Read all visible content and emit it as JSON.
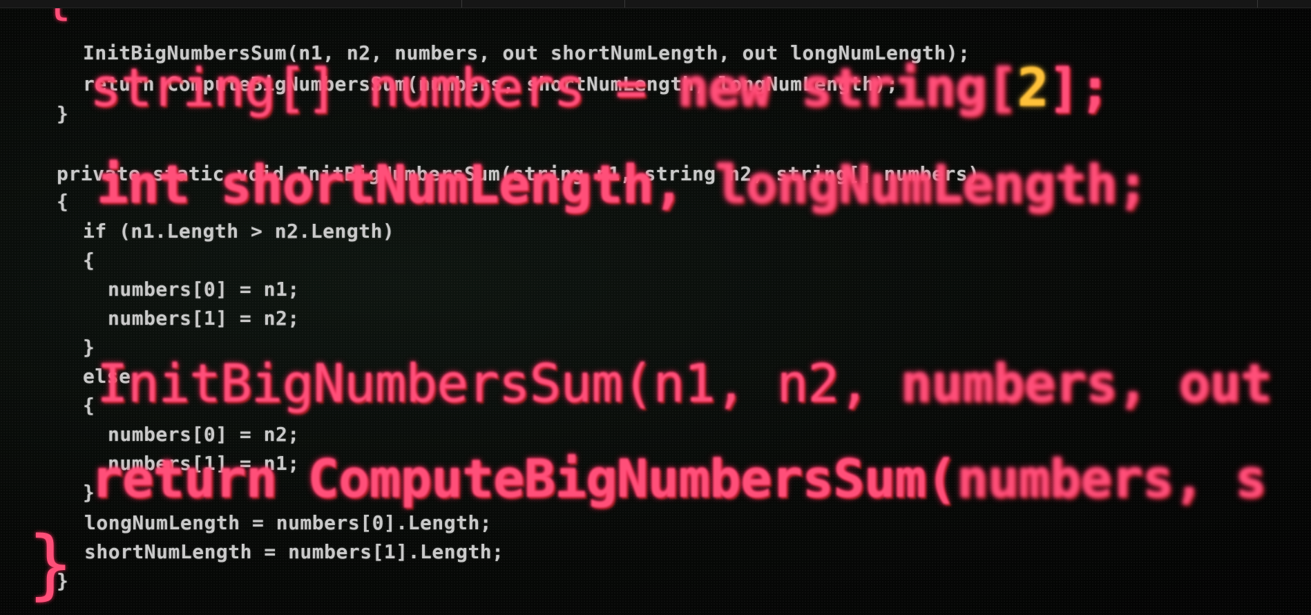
{
  "background_code": [
    "InitBigNumbersSum(n1, n2, numbers, out shortNumLength, out longNumLength);",
    "return ComputeBigNumbersSum(numbers, shortNumLength, longNumLength);",
    "}",
    "private static void InitBigNumbersSum(string n1, string n2, string[] numbers)",
    "{",
    "if (n1.Length > n2.Length)",
    "{",
    "numbers[0] = n1;",
    "numbers[1] = n2;",
    "}",
    "else",
    "{",
    "numbers[0] = n2;",
    "numbers[1] = n1;",
    "}",
    "longNumLength = numbers[0].Length;",
    "shortNumLength = numbers[1].Length;",
    "}"
  ],
  "foreground_code": {
    "line1_a": "string[] numbers = ",
    "line1_b": "new string[",
    "line1_num": "2",
    "line1_c": "];",
    "line2_a": "int shortNumLength, ",
    "line2_b": "longNumLength;",
    "line3_a": "InitBigNumbersSum(n1, n2, ",
    "line3_b": "numbers, out",
    "line4_a": "return ComputeBigNumbersSum(",
    "line4_b": "numbers, s"
  },
  "colors": {
    "glow_pink": "#ff4f79",
    "accent_gold": "#ffc23a",
    "code_gray": "#c9c9c9",
    "background": "#050505"
  }
}
